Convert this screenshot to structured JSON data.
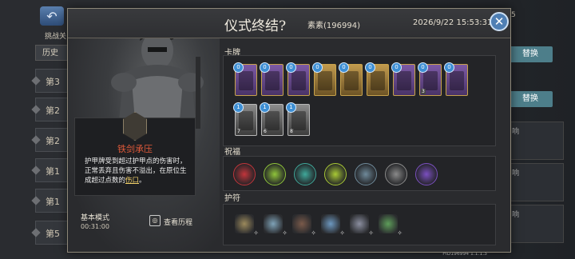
{
  "background": {
    "challenge_label": "挑战关",
    "history_tab": "历史",
    "floors": [
      "第3",
      "第2",
      "第2",
      "第1",
      "第1",
      "第5"
    ],
    "replace_buttons": [
      "替换",
      "替换"
    ],
    "right_text": [
      "5",
      "响",
      "响",
      "响",
      "响"
    ],
    "version": "PID196994  1.1.1.3"
  },
  "modal": {
    "title": "仪式终结?",
    "player": "素素(196994)",
    "datetime": "2026/9/22 15:53:31",
    "close_icon": "close-icon"
  },
  "tooltip": {
    "title": "铁剑承压",
    "desc_main": "护甲牌受到超过护甲点的伤害时，正常丢弃且伤害不溢出，在原位生成超过点数的",
    "desc_highlight": "伤口",
    "desc_tail": "。"
  },
  "mode": {
    "label": "基本模式",
    "timer": "00:31:00",
    "history_label": "查看历程"
  },
  "sections": {
    "cards_label": "卡牌",
    "blessings_label": "祝福",
    "amulets_label": "护符"
  },
  "cards": [
    {
      "cost": "0",
      "style": "purple",
      "icon": "claw-icon"
    },
    {
      "cost": "0",
      "style": "purple",
      "icon": "orb-icon"
    },
    {
      "cost": "0",
      "style": "purple",
      "icon": "mace-icon"
    },
    {
      "cost": "0",
      "style": "gold",
      "icon": "blade-icon"
    },
    {
      "cost": "0",
      "style": "gold",
      "icon": "reaper-icon"
    },
    {
      "cost": "0",
      "style": "gold",
      "icon": "warrior-icon"
    },
    {
      "cost": "0",
      "style": "purple",
      "icon": "potion-icon"
    },
    {
      "cost": "0",
      "style": "purple",
      "icon": "armor-icon",
      "num": "3"
    },
    {
      "cost": "0",
      "style": "purple",
      "icon": "hourglass-icon"
    },
    {
      "cost": "1",
      "style": "gray",
      "icon": "gauntlet-icon",
      "num": "7"
    },
    {
      "cost": "1",
      "style": "gray",
      "icon": "gauntlet-icon",
      "num": "6"
    },
    {
      "cost": "1",
      "style": "gray",
      "icon": "gauntlet-icon",
      "num": "8"
    }
  ],
  "blessings": [
    {
      "icon": "heart-shield-icon",
      "color": "#c2353b"
    },
    {
      "icon": "vine-shield-icon",
      "color": "#8fc43a"
    },
    {
      "icon": "skull-helm-icon",
      "color": "#3fa89a"
    },
    {
      "icon": "spiral-icon",
      "color": "#a8c935"
    },
    {
      "icon": "crown-icon",
      "color": "#6f8a9a"
    },
    {
      "icon": "winged-sword-icon",
      "color": "#8a8a8a"
    },
    {
      "icon": "bat-icon",
      "color": "#7b4fc0"
    }
  ],
  "amulets": [
    {
      "icon": "hammer-amulet-icon",
      "color": "#9c8a5c"
    },
    {
      "icon": "ghost-amulet-icon",
      "color": "#7fa3b8"
    },
    {
      "icon": "jar-amulet-icon",
      "color": "#7a5a4a"
    },
    {
      "icon": "cup-amulet-icon",
      "color": "#6d98c0"
    },
    {
      "icon": "horseshoe-amulet-icon",
      "color": "#8b8fa0"
    },
    {
      "icon": "lantern-amulet-icon",
      "color": "#5e9e5a"
    }
  ]
}
